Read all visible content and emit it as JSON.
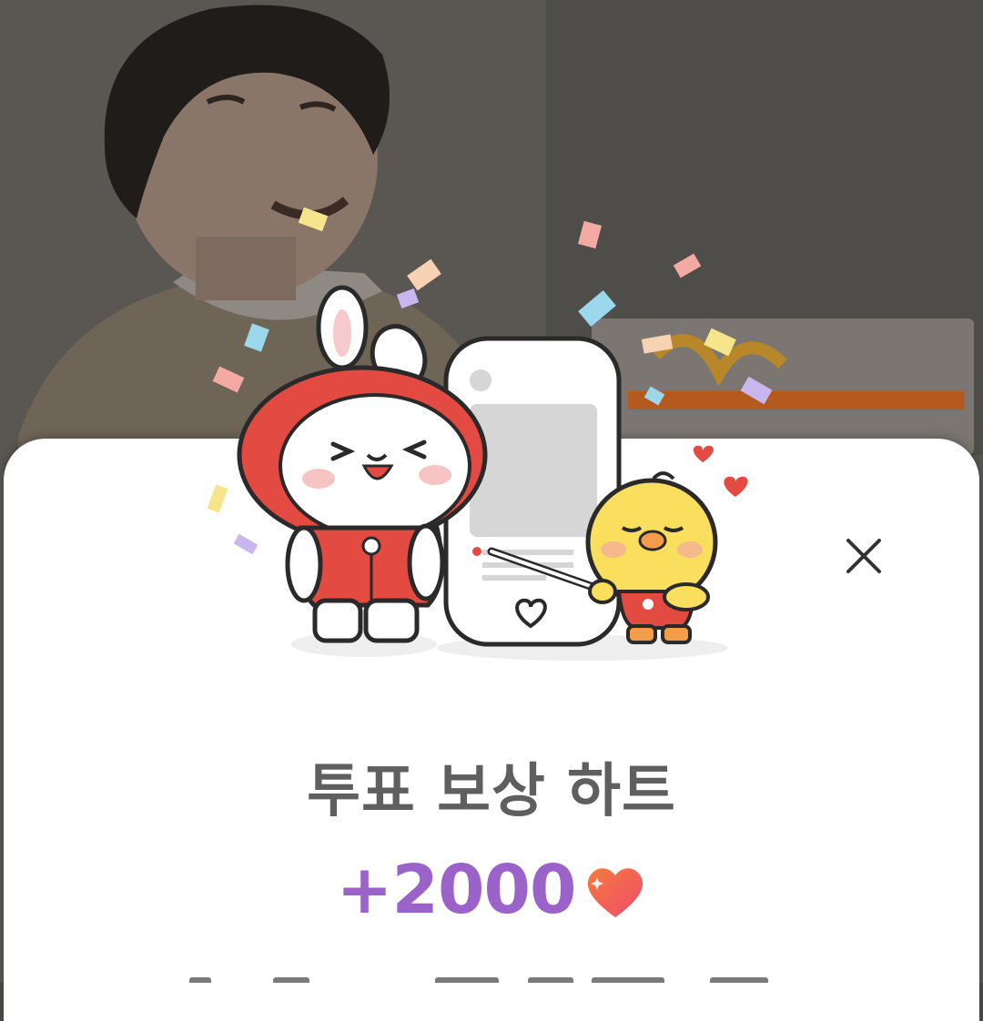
{
  "modal": {
    "title": "투표 보상 하트",
    "reward_amount": "+2000",
    "close_icon": "close-icon",
    "reward_icon": "heart-icon"
  },
  "colors": {
    "title": "#5f5f5f",
    "reward_amount": "#9b63c9",
    "heart_gradient_start": "#f47a3d",
    "heart_gradient_end": "#ef4d6b",
    "mascot_red": "#e24a42",
    "chick_yellow": "#f9df5d"
  }
}
